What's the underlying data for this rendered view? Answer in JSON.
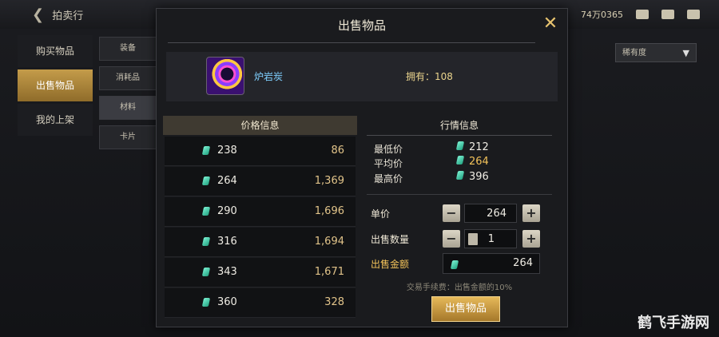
{
  "topbar": {
    "back_label": "拍卖行",
    "currency": "74万0365"
  },
  "left_nav": [
    {
      "label": "购买物品",
      "active": false
    },
    {
      "label": "出售物品",
      "active": true
    },
    {
      "label": "我的上架",
      "active": false
    }
  ],
  "sub_nav": [
    {
      "label": "装备",
      "active": false
    },
    {
      "label": "消耗品",
      "active": false
    },
    {
      "label": "材料",
      "active": true
    },
    {
      "label": "卡片",
      "active": false
    }
  ],
  "filter": {
    "label": "稀有度"
  },
  "modal": {
    "title": "出售物品",
    "item": {
      "name": "炉岩炭",
      "owned_label": "拥有：108"
    },
    "price_info": {
      "header": "价格信息",
      "rows": [
        {
          "price": "238",
          "qty": "86"
        },
        {
          "price": "264",
          "qty": "1,369"
        },
        {
          "price": "290",
          "qty": "1,696"
        },
        {
          "price": "316",
          "qty": "1,694"
        },
        {
          "price": "343",
          "qty": "1,671"
        },
        {
          "price": "360",
          "qty": "328"
        }
      ]
    },
    "market_info": {
      "header": "行情信息",
      "min_label": "最低价",
      "min_value": "212",
      "avg_label": "平均价",
      "avg_value": "264",
      "max_label": "最高价",
      "max_value": "396"
    },
    "form": {
      "unit_price_label": "单价",
      "unit_price_value": "264",
      "quantity_label": "出售数量",
      "quantity_value": "1",
      "total_label": "出售金额",
      "total_value": "264",
      "minus": "−",
      "plus": "+"
    },
    "fee_note": "交易手续费：出售金额的10%",
    "sell_button": "出售物品"
  },
  "watermark": "鹤飞手游网",
  "colors": {
    "gold": "#f2c25a",
    "gem": "#2fc79a",
    "item_name": "#7fd0ff"
  }
}
